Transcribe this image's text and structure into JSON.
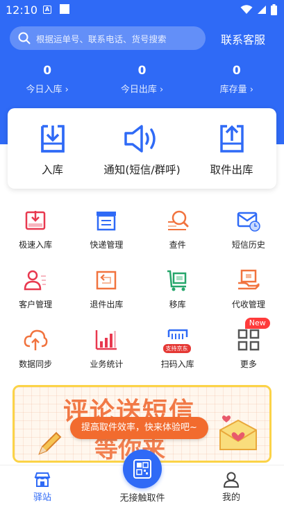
{
  "status_bar": {
    "time": "12:10",
    "a_icon_letter": "A"
  },
  "search": {
    "placeholder": "根据运单号、联系电话、货号搜索"
  },
  "service_link": "联系客服",
  "stats": [
    {
      "value": "0",
      "label": "今日入库 ›"
    },
    {
      "value": "0",
      "label": "今日出库 ›"
    },
    {
      "value": "0",
      "label": "库存量 ›"
    }
  ],
  "main_actions": [
    {
      "label": "入库",
      "icon": "inbox-arrow-down-icon"
    },
    {
      "label": "通知(短信/群呼)",
      "icon": "speaker-icon"
    },
    {
      "label": "取件出库",
      "icon": "outbox-arrow-up-icon"
    }
  ],
  "grid": [
    {
      "label": "极速入库",
      "icon": "fast-inbound-icon"
    },
    {
      "label": "快递管理",
      "icon": "courier-management-icon"
    },
    {
      "label": "查件",
      "icon": "parcel-search-icon"
    },
    {
      "label": "短信历史",
      "icon": "sms-history-icon"
    },
    {
      "label": "客户管理",
      "icon": "customer-icon"
    },
    {
      "label": "退件出库",
      "icon": "return-icon"
    },
    {
      "label": "移库",
      "icon": "cart-move-icon"
    },
    {
      "label": "代收管理",
      "icon": "collection-icon"
    },
    {
      "label": "数据同步",
      "icon": "cloud-sync-icon"
    },
    {
      "label": "业务统计",
      "icon": "bar-chart-icon"
    },
    {
      "label": "扫码入库",
      "icon": "scan-inbound-icon"
    },
    {
      "label": "更多",
      "icon": "more-grid-icon"
    }
  ],
  "badges": {
    "new": "New",
    "jd": "支持京东"
  },
  "banner": {
    "title_line1": "评论送短信",
    "title_line2": "等你来",
    "pill": "提高取件效率，快来体验吧~"
  },
  "bottom_nav": {
    "home": "驿站",
    "center": "无接触取件",
    "mine": "我的"
  },
  "colors": {
    "primary": "#2f6af6",
    "accent_red": "#e8384f",
    "accent_orange": "#f1733e"
  }
}
